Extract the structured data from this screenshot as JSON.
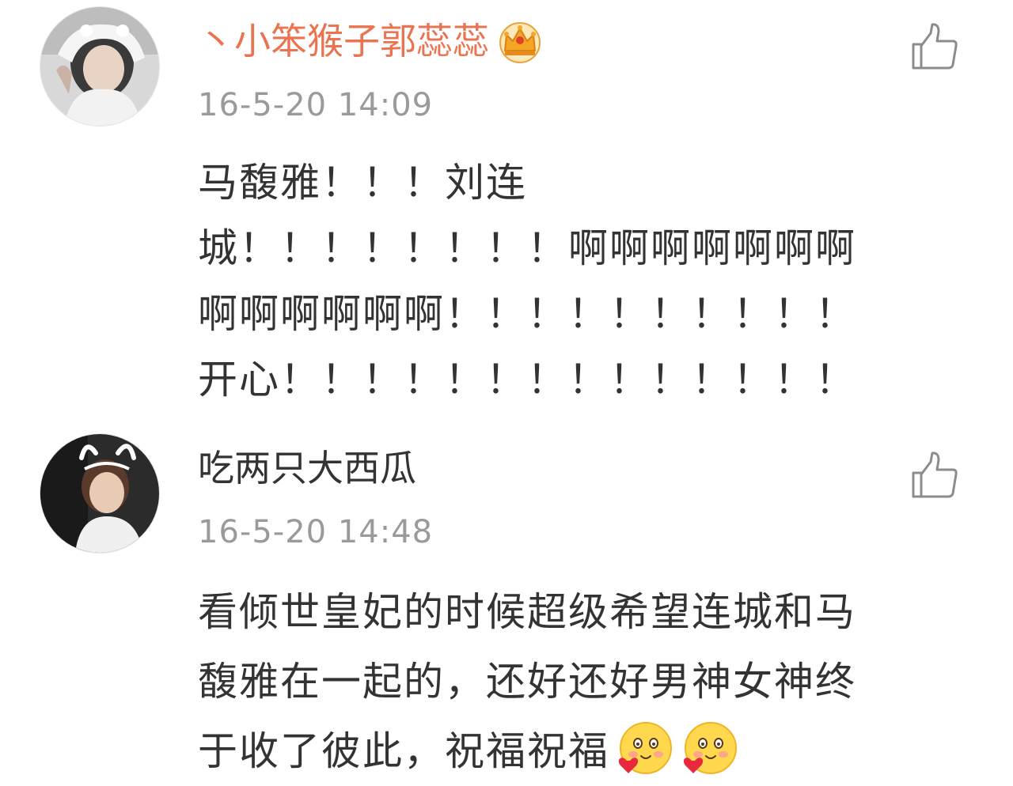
{
  "comments": [
    {
      "username": "丶小笨猴子郭蕊蕊",
      "timestamp": "16-5-20 14:09",
      "text_lines": [
        "马馥雅！！！刘连",
        "城！！！！！！！！啊啊啊啊啊啊啊",
        "啊啊啊啊啊啊！！！！！！！！！！",
        "开心！！！！！！！！！！！！！！"
      ],
      "badge_icon": "crown-vip-icon",
      "like_icon": "thumbs-up-icon"
    },
    {
      "username": "吃两只大西瓜",
      "timestamp": "16-5-20 14:48",
      "text_lines": [
        "看倾世皇妃的时候超级希望连城和马",
        "馥雅在一起的，还好还好男神女神终",
        "于收了彼此，祝福祝福"
      ],
      "emoji_icons": [
        "blush-heart-emoji",
        "blush-heart-emoji"
      ],
      "like_icon": "thumbs-up-icon"
    }
  ],
  "colors": {
    "vip_name": "#eb7350",
    "normal_name": "#333333",
    "timestamp": "#9a9a9a",
    "text": "#333333",
    "icon_gray": "#8c8c8c",
    "crown": "#f5a623"
  }
}
